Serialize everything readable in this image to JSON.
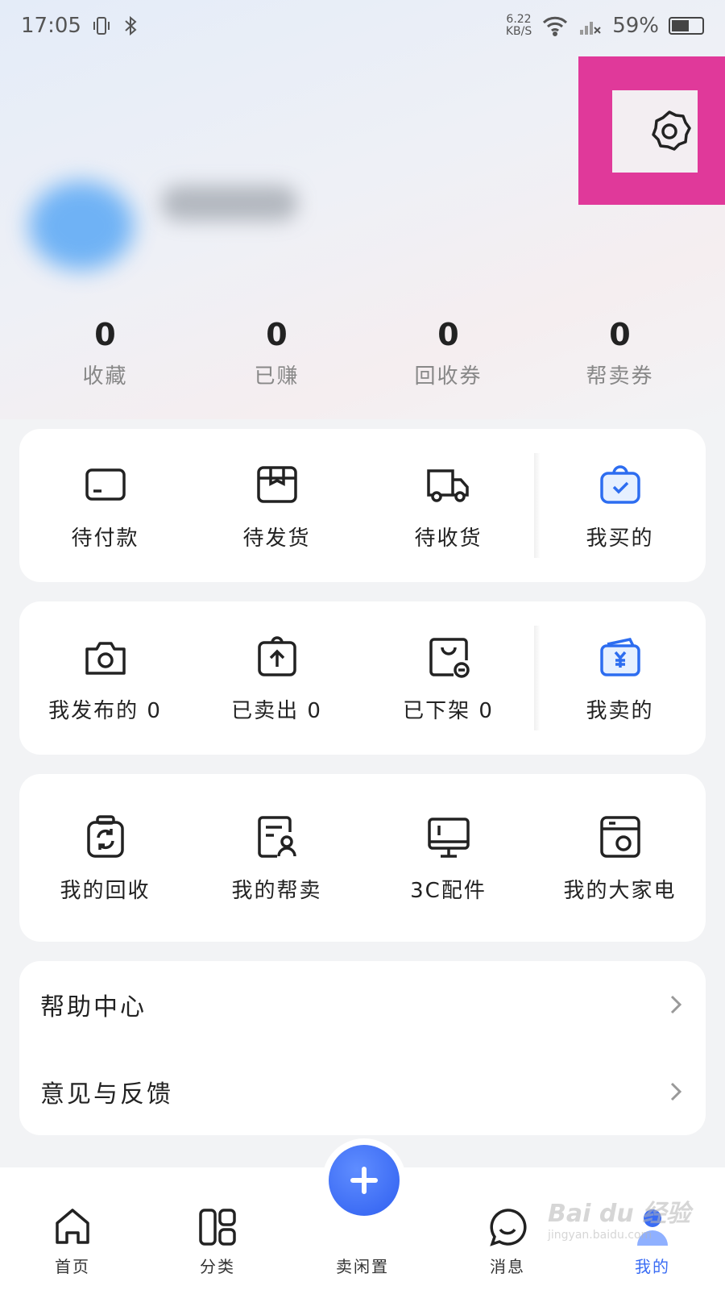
{
  "status_bar": {
    "time": "17:05",
    "net_speed_value": "6.22",
    "net_speed_unit": "KB/S",
    "battery": "59%"
  },
  "stats": [
    {
      "value": "0",
      "label": "收藏"
    },
    {
      "value": "0",
      "label": "已赚"
    },
    {
      "value": "0",
      "label": "回收券"
    },
    {
      "value": "0",
      "label": "帮卖券"
    }
  ],
  "buy_orders": {
    "items": [
      {
        "label": "待付款",
        "icon": "card-icon"
      },
      {
        "label": "待发货",
        "icon": "package-box-icon"
      },
      {
        "label": "待收货",
        "icon": "truck-icon"
      },
      {
        "label": "我买的",
        "icon": "shopping-bag-icon"
      }
    ]
  },
  "sell_orders": {
    "items": [
      {
        "label": "我发布的 0",
        "icon": "camera-icon"
      },
      {
        "label": "已卖出 0",
        "icon": "upload-bag-icon"
      },
      {
        "label": "已下架 0",
        "icon": "bag-minus-icon"
      },
      {
        "label": "我卖的",
        "icon": "wallet-yuan-icon"
      }
    ]
  },
  "services": {
    "items": [
      {
        "label": "我的回收",
        "icon": "recycle-icon"
      },
      {
        "label": "我的帮卖",
        "icon": "doc-person-icon"
      },
      {
        "label": "3C配件",
        "icon": "monitor-icon"
      },
      {
        "label": "我的大家电",
        "icon": "appliance-icon"
      }
    ]
  },
  "list": [
    {
      "label": "帮助中心"
    },
    {
      "label": "意见与反馈"
    }
  ],
  "bottom_nav": [
    {
      "label": "首页",
      "icon": "home-icon"
    },
    {
      "label": "分类",
      "icon": "category-icon"
    },
    {
      "label": "卖闲置",
      "icon": "plus-icon"
    },
    {
      "label": "消息",
      "icon": "chat-icon"
    },
    {
      "label": "我的",
      "icon": "user-icon"
    }
  ],
  "watermark": {
    "logo": "Bai du 经验",
    "url": "jingyan.baidu.com"
  },
  "colors": {
    "accent": "#3a6cf4",
    "highlight": "#e0399a"
  }
}
